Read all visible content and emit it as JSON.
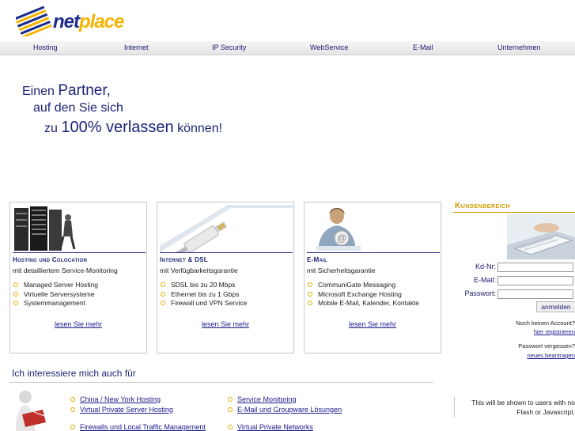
{
  "brand": {
    "part1": "net",
    "part2": "place"
  },
  "nav": [
    "Hosting",
    "Internet",
    "IP Security",
    "WebService",
    "E-Mail",
    "Unternehmen"
  ],
  "tagline": {
    "l1a": "Einen ",
    "l1b": "Partner,",
    "l2": "auf den Sie sich",
    "l3a": "zu ",
    "l3b": "100% verlassen",
    "l3c": " können!"
  },
  "cards": [
    {
      "image": "server-rack-image",
      "title": "Hosting und Colocation",
      "subtitle": "mit detailliertem Service-Monitoring",
      "items": [
        "Managed Server Hosting",
        "Virtuelle Serversysteme",
        "Systemmanagement"
      ],
      "more": "lesen Sie mehr"
    },
    {
      "image": "network-cable-image",
      "title": "Internet & DSL",
      "subtitle": "mit Verfügbarkeitsgarantie",
      "items": [
        "SDSL bis zu 20 Mbps",
        "Ethernet bis zu 1 Gbps",
        "Firewall und VPN Service"
      ],
      "more": "lesen Sie mehr"
    },
    {
      "image": "email-woman-image",
      "title": "E-Mail",
      "subtitle": "mit Sicherheitsgarantie",
      "items": [
        "CommuniGate Messaging",
        "Microsoft Exchange Hosting",
        "Mobile E-Mail, Kalender, Kontakte"
      ],
      "more": "lesen Sie mehr"
    }
  ],
  "kundenbereich": {
    "title": "Kundenbereich",
    "labels": {
      "kdnr": "Kd-Nr:",
      "email": "E-Mail:",
      "password": "Passwort:"
    },
    "values": {
      "kdnr": "",
      "email": "",
      "password": ""
    },
    "submit": "anmelden",
    "no_account": "Noch keinen Account?",
    "register": "hier registrieren",
    "forgot": "Passwort vergessen?",
    "request": "neues beantragen"
  },
  "interest": {
    "title": "Ich interessiere mich auch für",
    "col1": [
      "China / New York Hosting",
      "Virtual Private Server Hosting",
      "Firewalls und Local Traffic Management"
    ],
    "col2": [
      "Service Monitoring",
      "E-Mail und Groupware Lösungen",
      "Virtual Private Networks"
    ]
  },
  "flash_notice": {
    "line1": "This will be shown to users with no",
    "line2": "Flash or Javascript."
  },
  "colors": {
    "brand_blue": "#1c2a8a",
    "brand_yellow": "#f5b400",
    "heading_blue": "#1c2478",
    "kb_gold": "#d29b00"
  }
}
